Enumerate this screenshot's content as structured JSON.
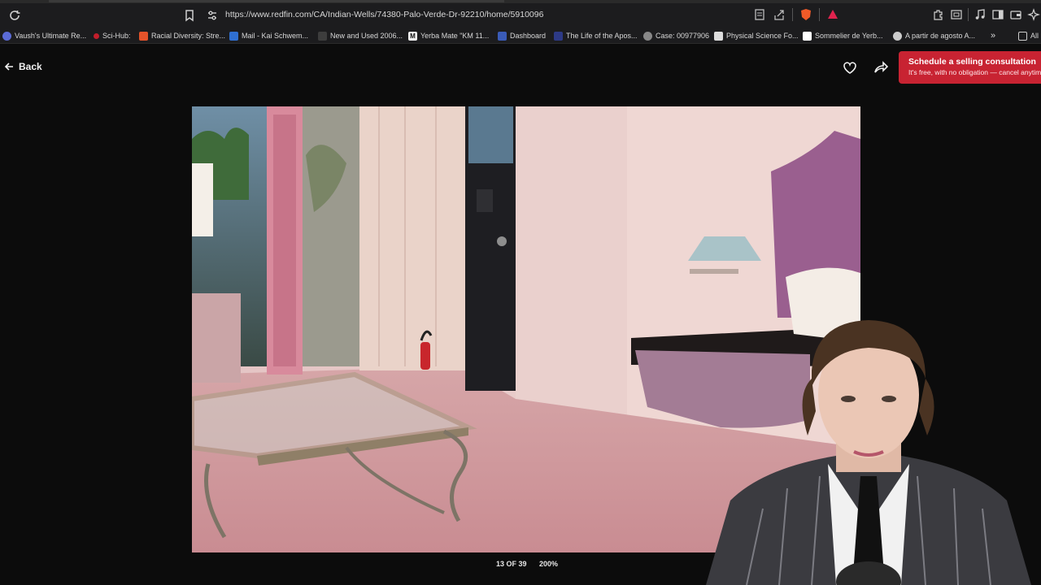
{
  "browser": {
    "url": "https://www.redfin.com/CA/Indian-Wells/74380-Palo-Verde-Dr-92210/home/5910096",
    "bookmarks": [
      {
        "label": "Vaush's Ultimate Re...",
        "favicon_color": "#5b6bd6"
      },
      {
        "label": "Sci-Hub:",
        "favicon_color": "#c21e2b"
      },
      {
        "label": "Racial Diversity: Stre...",
        "favicon_color": "#e5532a"
      },
      {
        "label": "Mail - Kai Schwem...",
        "favicon_color": "#2f6fd0"
      },
      {
        "label": "New and Used 2006...",
        "favicon_color": "#3d3d3d"
      },
      {
        "label": "Yerba Mate \"KM 11...",
        "favicon_color": "#f0f0f0"
      },
      {
        "label": "Dashboard",
        "favicon_color": "#3a5bb8"
      },
      {
        "label": "The Life of the Apos...",
        "favicon_color": "#2d3a86"
      },
      {
        "label": "Case: 00977906",
        "favicon_color": "#888888"
      },
      {
        "label": "Physical Science Fo...",
        "favicon_color": "#dddddd"
      },
      {
        "label": "Sommelier de Yerb...",
        "favicon_color": "#ffffff"
      },
      {
        "label": "A partir de agosto A...",
        "favicon_color": "#cccccc"
      },
      {
        "label": "All",
        "favicon_color": "#cccccc"
      }
    ],
    "overflow_icon": "chevrons-right-icon"
  },
  "page": {
    "back_label": "Back",
    "cta_title": "Schedule a selling consultation",
    "cta_subtitle": "It's free, with no obligation — cancel anytime",
    "photo_counter": "13 OF 39",
    "zoom_level": "200%",
    "photo_subject": "pink bedroom with glass coffee table, nightstand and wall lamp"
  },
  "colors": {
    "accent": "#c82332",
    "background": "#0c0c0c",
    "chrome": "#1c1c1e"
  }
}
